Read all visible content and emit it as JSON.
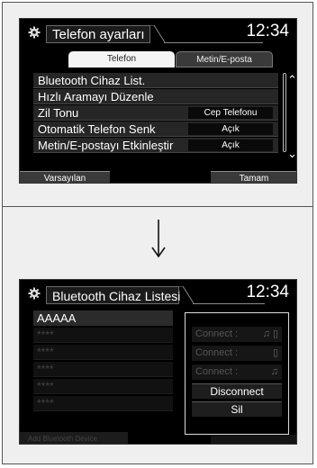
{
  "top_screen": {
    "title": "Telefon ayarları",
    "clock": "12:34",
    "tabs": [
      {
        "label": "Telefon",
        "active": true
      },
      {
        "label": "Metin/E-posta",
        "active": false
      }
    ],
    "menu_items": [
      {
        "label": "Bluetooth Cihaz List.",
        "value": null
      },
      {
        "label": "Hızlı Aramayı Düzenle",
        "value": null
      },
      {
        "label": "Zil Tonu",
        "value": "Cep Telefonu"
      },
      {
        "label": "Otomatik Telefon Senk",
        "value": "Açık"
      },
      {
        "label": "Metin/E-postayı Etkinleştir",
        "value": "Açık"
      }
    ],
    "default_button": "Varsayılan",
    "ok_button": "Tamam"
  },
  "bottom_screen": {
    "title": "Bluetooth Cihaz Listesi",
    "clock": "12:34",
    "devices": [
      "AAAAA",
      "****",
      "****",
      "****",
      "****",
      "****"
    ],
    "popup": {
      "connect_rows": [
        {
          "label": "Connect :",
          "icons": "♫ ▯"
        },
        {
          "label": "Connect :",
          "icons": "▯"
        },
        {
          "label": "Connect :",
          "icons": "♫"
        }
      ],
      "disconnect_label": "Disconnect",
      "delete_label": "Sil"
    },
    "add_device_label": "Add Bluetooth Device"
  },
  "icons": {
    "settings": "gear-icon",
    "scroll_up": "double-chevron-up-icon",
    "scroll_down": "double-chevron-down-icon",
    "transition": "arrow-down-icon"
  },
  "colors": {
    "screen_bg": "#000000",
    "active_tab": "#f4f4f4",
    "row_bg": "#262626",
    "panel_bg": "#efefef"
  }
}
